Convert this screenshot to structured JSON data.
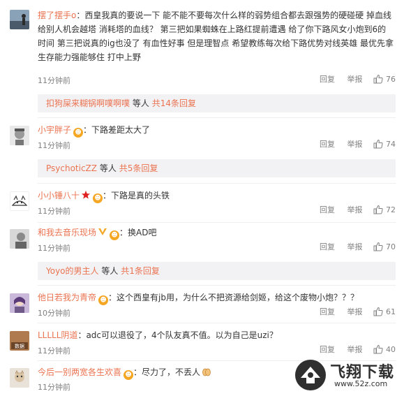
{
  "actions": {
    "reply": "回复",
    "report": "举报"
  },
  "comments": [
    {
      "user": "摆了摆手o",
      "text": "：西皇我真的要说一下 能不能不要每次什么样的弱势组合都去跟强势的硬碰硬 掉血线 给别人机会越塔 消耗塔的血线？ 第三把如果蜘蛛在上路红提前遭遇 给了你下路风女小炮到6的时间 第三把说真的ig也没了 有血性好事 但是理智点 希望教练每次给下路优势对线英雄 最优先拿 生存能力强能够住 打中上野",
      "time": "11分钟前",
      "likes": "76",
      "reply_summary": {
        "name": "扣狗屎来糊锅啊噗啊噗",
        "middle": "等人",
        "count": "共14条回复"
      }
    },
    {
      "user": "小宇胖子",
      "badge": "V",
      "text": "：下路差距太大了",
      "time": "11分钟前",
      "likes": "74",
      "reply_summary": {
        "name": "PsychoticZZ",
        "middle": "等人",
        "count": "共5条回复"
      }
    },
    {
      "user": "小小锤八十",
      "badge": "V",
      "text": "：下路是真的头铁",
      "time": "11分钟前",
      "likes": "72"
    },
    {
      "user": "和我去音乐现场",
      "badge": "V",
      "text": "：换AD吧",
      "time": "11分钟前",
      "likes": "70",
      "reply_summary": {
        "name": "Yoyo的男主人",
        "middle": "等人",
        "count": "共1条回复"
      }
    },
    {
      "user": "他日若我为青帝",
      "badge": "V",
      "text": "：这个西皇有jb用，为什么不把资源给剑姬，给这个废物小炮？？？",
      "time": "10分钟前",
      "likes": "61"
    },
    {
      "user": "LLLLL阴道",
      "text": "：adc可以退役了，4个队友真不值。以为自己是uzi？",
      "time": "11分钟前",
      "likes": "40"
    },
    {
      "user": "今后一别两宽各生欢喜",
      "badge": "V",
      "text": "：尽力了，不丢人",
      "time": "11分钟前",
      "likes": ""
    }
  ],
  "watermark": {
    "title": "飞翔下载",
    "url": "www.52z.com"
  }
}
